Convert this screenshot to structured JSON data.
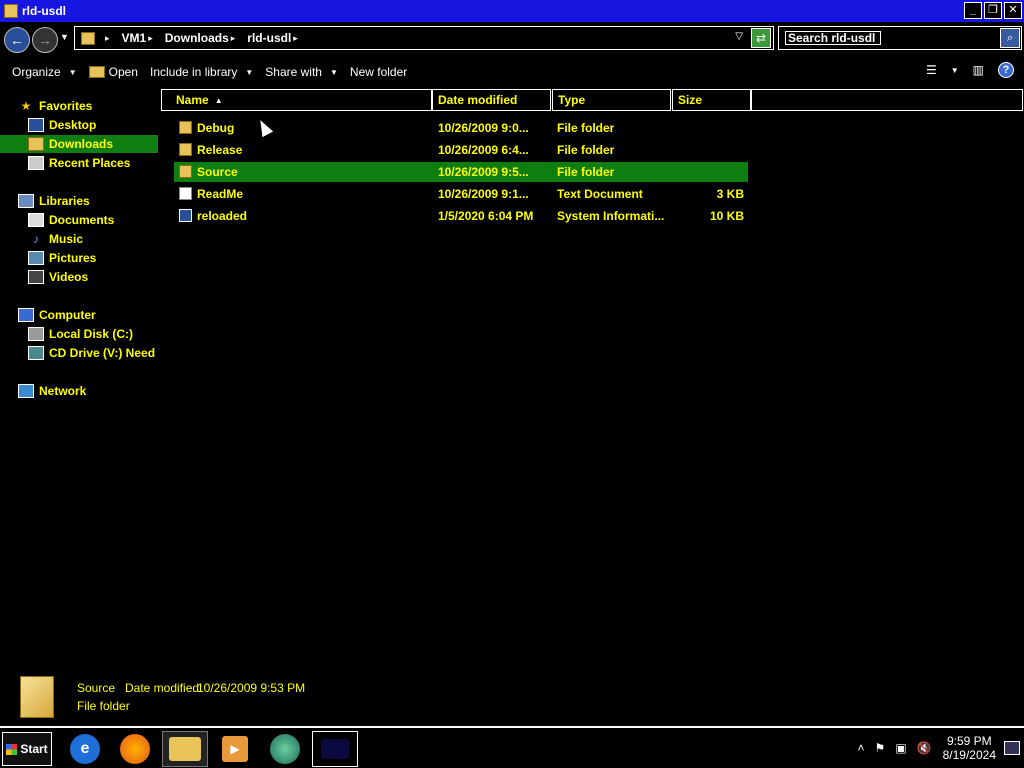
{
  "window": {
    "title": "rld-usdl"
  },
  "address": {
    "crumbs": [
      "VM1",
      "Downloads",
      "rld-usdl"
    ]
  },
  "search": {
    "value": "Search rld-usdl"
  },
  "commands": {
    "organize": "Organize",
    "open": "Open",
    "include_in_library": "Include in library",
    "share_with": "Share with",
    "new_folder": "New folder"
  },
  "nav": {
    "favorites": "Favorites",
    "desktop": "Desktop",
    "downloads": "Downloads",
    "recent_places": "Recent Places",
    "libraries": "Libraries",
    "documents": "Documents",
    "music": "Music",
    "pictures": "Pictures",
    "videos": "Videos",
    "computer": "Computer",
    "local_disk": "Local Disk (C:)",
    "cd_drive": "CD Drive (V:) Need",
    "network": "Network"
  },
  "columns": {
    "name": "Name",
    "date_modified": "Date modified",
    "type": "Type",
    "size": "Size"
  },
  "files": [
    {
      "name": "Debug",
      "date": "10/26/2009 9:0...",
      "type": "File folder",
      "size": "",
      "icon": "folder-icon"
    },
    {
      "name": "Release",
      "date": "10/26/2009 6:4...",
      "type": "File folder",
      "size": "",
      "icon": "folder-icon"
    },
    {
      "name": "Source",
      "date": "10/26/2009 9:5...",
      "type": "File folder",
      "size": "",
      "icon": "folder-icon",
      "selected": true
    },
    {
      "name": "ReadMe",
      "date": "10/26/2009 9:1...",
      "type": "Text Document",
      "size": "3 KB",
      "icon": "text-document-icon"
    },
    {
      "name": "reloaded",
      "date": "1/5/2020 6:04 PM",
      "type": "System Informati...",
      "size": "10 KB",
      "icon": "system-information-icon"
    }
  ],
  "details": {
    "name": "Source",
    "date_label": "Date modified:",
    "date_value": "10/26/2009 9:53 PM",
    "type": "File folder"
  },
  "taskbar": {
    "start": "Start",
    "apps": [
      "internet-explorer-icon",
      "firefox-icon",
      "windows-explorer-icon",
      "media-player-icon",
      "app-icon",
      "app-icon"
    ],
    "time": "9:59 PM",
    "date": "8/19/2024"
  },
  "colors": {
    "title_bar": "#1616e0",
    "selection": "#0f7e10",
    "text": "#ffff00",
    "background": "#000000"
  }
}
